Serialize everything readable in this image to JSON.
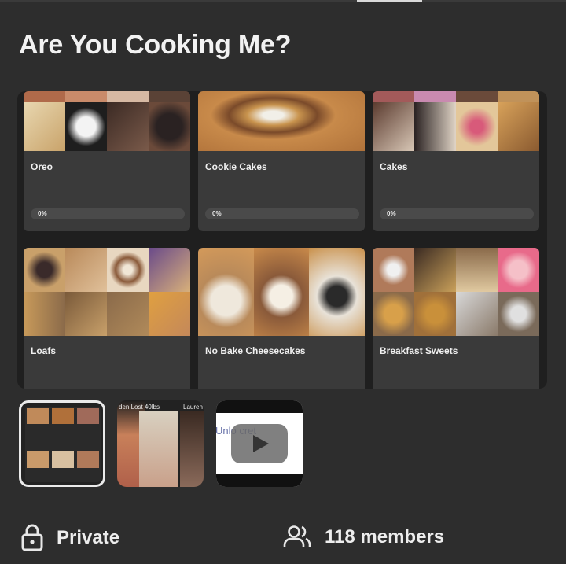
{
  "group": {
    "title": "Are You Cooking Me?"
  },
  "cards": [
    {
      "title": "Oreo",
      "progress_label": "0%",
      "progress": 0
    },
    {
      "title": "Cookie Cakes",
      "progress_label": "0%",
      "progress": 0
    },
    {
      "title": "Cakes",
      "progress_label": "0%",
      "progress": 0
    },
    {
      "title": "Loafs"
    },
    {
      "title": "No Bake Cheesecakes"
    },
    {
      "title": "Breakfast Sweets"
    }
  ],
  "media": {
    "promo_left": "den Lost 40lbs",
    "promo_right": "Lauren Lo",
    "video_text": "Unlo       cret"
  },
  "footer": {
    "privacy_label": "Private",
    "members_label": "118 members"
  },
  "colors": {
    "background": "#2d2d2d",
    "card": "#3a3a3a",
    "progress_track": "#4a4a4a"
  },
  "icons": {
    "privacy": "lock-icon",
    "members": "people-icon",
    "video": "play-icon"
  }
}
